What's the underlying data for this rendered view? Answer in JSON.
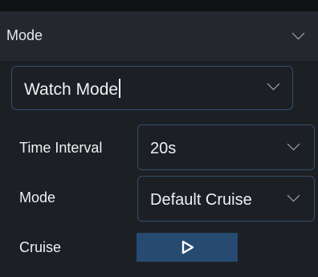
{
  "header": {
    "title": "Mode",
    "icon": "chevron-down-icon"
  },
  "watch_mode_select": {
    "value": "Watch Mode",
    "icon": "chevron-down-icon"
  },
  "time_interval": {
    "label": "Time Interval",
    "value": "20s",
    "icon": "chevron-down-icon"
  },
  "mode_field": {
    "label": "Mode",
    "value": "Default Cruise",
    "icon": "chevron-down-icon"
  },
  "cruise": {
    "label": "Cruise",
    "button_icon": "play-icon"
  },
  "colors": {
    "background": "#1c1f24",
    "header_background": "#24272d",
    "select_border": "#33506e",
    "button_background": "#264a70",
    "text": "#eef0f3"
  }
}
